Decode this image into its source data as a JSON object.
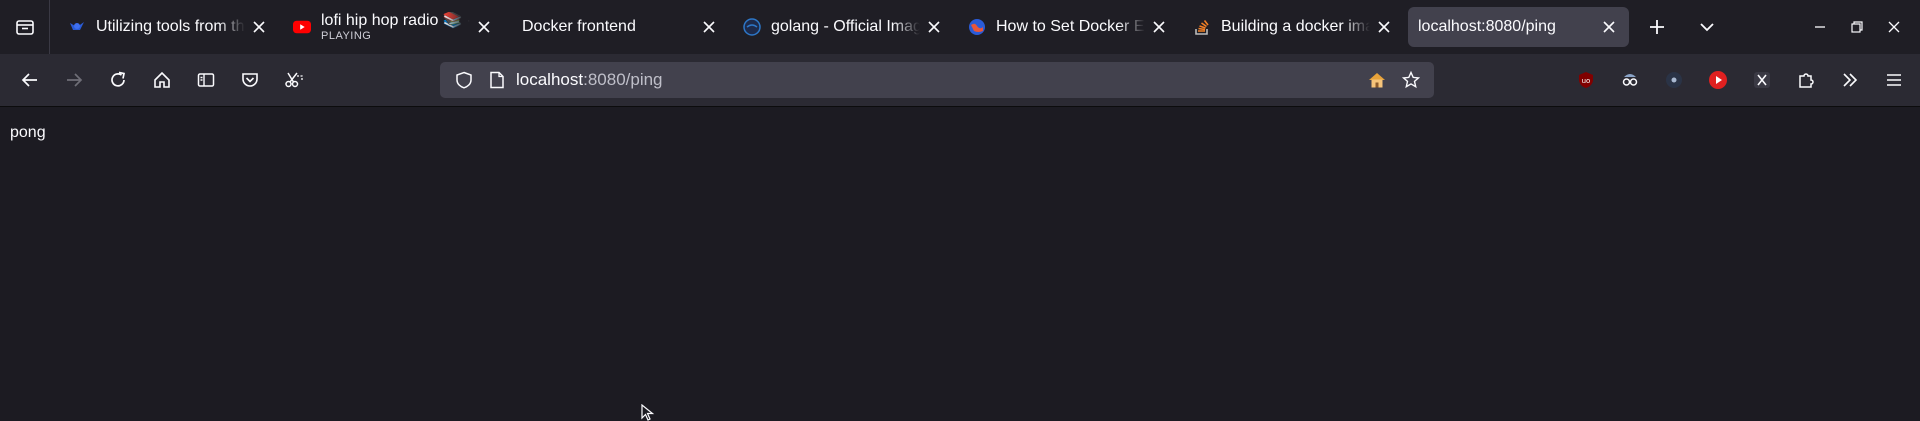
{
  "tabs": [
    {
      "title": "Utilizing tools from the",
      "icon": "blue-bird-icon"
    },
    {
      "title": "lofi hip hop radio 📚 -",
      "subtitle": "PLAYING",
      "icon": "youtube-icon"
    },
    {
      "title": "Docker frontend",
      "icon": "none"
    },
    {
      "title": "golang - Official Image",
      "icon": "docker-icon"
    },
    {
      "title": "How to Set Docker Env",
      "icon": "globe-icon"
    },
    {
      "title": "Building a docker image",
      "icon": "stackoverflow-icon"
    },
    {
      "title": "localhost:8080/ping",
      "icon": "none",
      "active": true
    }
  ],
  "urlbar": {
    "host": "localhost",
    "rest": ":8080/ping"
  },
  "page": {
    "body_text": "pong"
  },
  "colors": {
    "background": "#1c1b22",
    "tabstrip": "#1f1e25",
    "navbar": "#2b2a33",
    "active_tab": "#42414d",
    "urlbar": "#42414d"
  }
}
